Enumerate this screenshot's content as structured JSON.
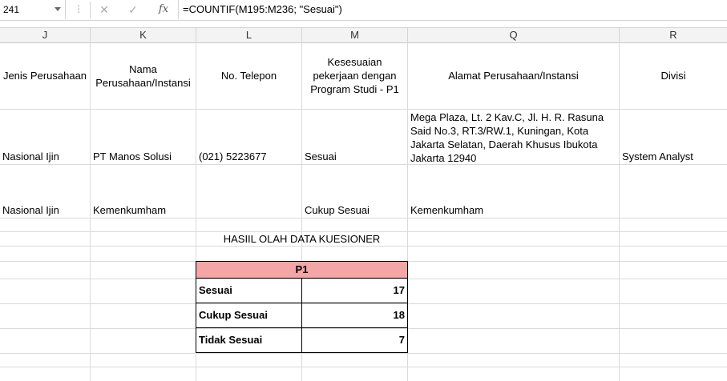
{
  "formula_bar": {
    "name_box": "241",
    "formula": "=COUNTIF(M195:M236; \"Sesuai\")",
    "cancel_icon": "close-icon",
    "enter_icon": "check-icon",
    "fx_label": "fx"
  },
  "columns": [
    "J",
    "K",
    "L",
    "M",
    "Q",
    "R"
  ],
  "header_row": {
    "J": "Jenis Perusahaan",
    "K": "Nama Perusahaan/Instansi",
    "L": "No. Telepon",
    "M": "Kesesuaian pekerjaan dengan Program Studi - P1",
    "Q": "Alamat Perusahaan/Instansi",
    "R": "Divisi"
  },
  "rows": [
    {
      "J": "Nasional Ijin",
      "K": "PT Manos Solusi",
      "L": "(021) 5223677",
      "M": "Sesuai",
      "Q": "Mega Plaza, Lt. 2 Kav.C, Jl. H. R. Rasuna Said No.3, RT.3/RW.1, Kuningan, Kota Jakarta Selatan, Daerah Khusus Ibukota Jakarta 12940",
      "R": "System Analyst"
    },
    {
      "J": "Nasional Ijin",
      "K": "Kemenkumham",
      "L": "",
      "M": "Cukup Sesuai",
      "Q": "Kemenkumham",
      "R": ""
    }
  ],
  "summary": {
    "title": "HASIIL OLAH DATA KUESIONER",
    "header": "P1",
    "items": [
      {
        "label": "Sesuai",
        "value": "17"
      },
      {
        "label": "Cukup Sesuai",
        "value": "18"
      },
      {
        "label": "Tidak Sesuai",
        "value": "7"
      }
    ]
  }
}
